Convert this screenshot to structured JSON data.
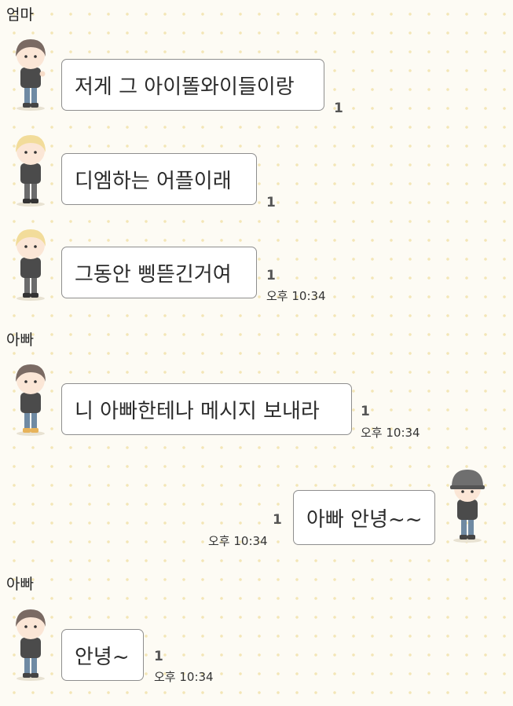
{
  "messages": [
    {
      "sender": "엄마",
      "text": "저게 그 아이똘와이들이랑",
      "unread": "1",
      "time": ""
    },
    {
      "sender": "",
      "text": "디엠하는 어플이래",
      "unread": "1",
      "time": ""
    },
    {
      "sender": "",
      "text": "그동안 삥뜯긴거여",
      "unread": "1",
      "time": "오후 10:34"
    },
    {
      "sender": "아빠",
      "text": "니 아빠한테나 메시지 보내라",
      "unread": "1",
      "time": "오후 10:34"
    },
    {
      "sender": "",
      "text": "아빠 안녕~~",
      "unread": "1",
      "time": "오후 10:34",
      "outgoing": true
    },
    {
      "sender": "아빠",
      "text": "안녕~",
      "unread": "1",
      "time": "오후 10:34"
    }
  ],
  "avatars": [
    {
      "icon": "avatar-brown-hair",
      "hair": "#7a6a63"
    },
    {
      "icon": "avatar-blonde-hair",
      "hair": "#f2dc9a"
    },
    {
      "icon": "avatar-blonde-hair",
      "hair": "#f2dc9a"
    },
    {
      "icon": "avatar-brown-hair",
      "hair": "#7a6a63"
    },
    {
      "icon": "avatar-gray-cap",
      "hair": "#6f6f6f"
    },
    {
      "icon": "avatar-brown-hair",
      "hair": "#7a6a63"
    }
  ],
  "colors": {
    "background": "#fdfbf4",
    "dots": "#f3e6b6",
    "bubble_border": "#8e8e8e"
  }
}
